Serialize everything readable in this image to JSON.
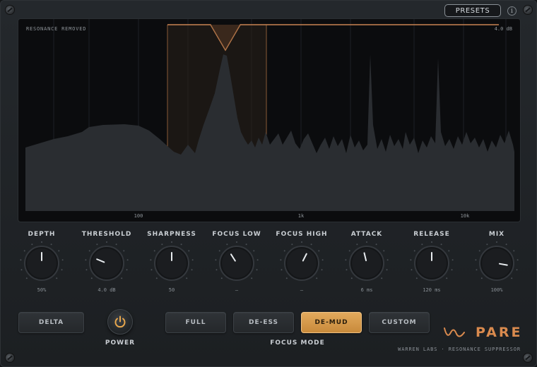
{
  "header": {
    "presets_label": "PRESETS",
    "info_label": "i"
  },
  "display": {
    "title": "RESONANCE REMOVED",
    "db_readout": "4.0 dB",
    "freq_labels": [
      "100",
      "1k",
      "10k"
    ]
  },
  "knobs": [
    {
      "label": "DEPTH",
      "value": "50%",
      "level": 0.5
    },
    {
      "label": "THRESHOLD",
      "value": "4.0 dB",
      "level": 0.25
    },
    {
      "label": "SHARPNESS",
      "value": "50",
      "level": 0.5
    },
    {
      "label": "FOCUS LOW",
      "value": "—",
      "level": 0.38
    },
    {
      "label": "FOCUS HIGH",
      "value": "—",
      "level": 0.6
    },
    {
      "label": "ATTACK",
      "value": "6 ms",
      "level": 0.45
    },
    {
      "label": "RELEASE",
      "value": "120 ms",
      "level": 0.5
    },
    {
      "label": "MIX",
      "value": "100%",
      "level": 0.87
    }
  ],
  "buttons": {
    "delta": "DELTA",
    "power_label": "POWER",
    "focus_modes": [
      {
        "label": "FULL",
        "active": false
      },
      {
        "label": "DE-ESS",
        "active": false
      },
      {
        "label": "DE-MUD",
        "active": true
      },
      {
        "label": "CUSTOM",
        "active": false
      }
    ],
    "focus_mode_label": "FOCUS MODE"
  },
  "brand": {
    "name": "PARE",
    "subtitle": "WARREN LABS  ·  RESONANCE SUPPRESSOR"
  },
  "colors": {
    "accent": "#e2a95c",
    "brand": "#d98a4e",
    "power_icon": "#e8a74d"
  }
}
